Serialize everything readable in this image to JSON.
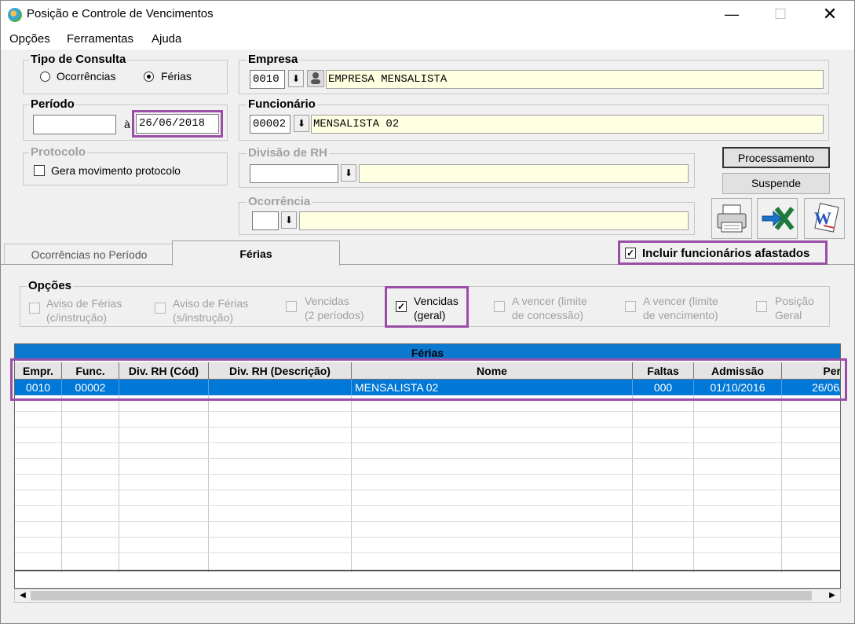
{
  "window": {
    "title": "Posição e Controle de Vencimentos"
  },
  "menu": [
    "Opções",
    "Ferramentas",
    "Ajuda"
  ],
  "tipo_consulta": {
    "label": "Tipo de Consulta",
    "options": [
      "Ocorrências",
      "Férias"
    ],
    "selected": "Férias"
  },
  "periodo": {
    "label": "Período",
    "from": "",
    "sep": "à",
    "to": "26/06/2018"
  },
  "protocolo": {
    "label": "Protocolo",
    "checkbox": "Gera movimento protocolo"
  },
  "empresa": {
    "label": "Empresa",
    "code": "0010",
    "name": "EMPRESA MENSALISTA"
  },
  "funcionario": {
    "label": "Funcionário",
    "code": "00002",
    "name": "MENSALISTA 02"
  },
  "divisao": {
    "label": "Divisão de RH",
    "code": "",
    "name": ""
  },
  "ocorrencia": {
    "label": "Ocorrência",
    "code": "",
    "name": ""
  },
  "buttons": {
    "processamento": "Processamento",
    "suspende": "Suspende"
  },
  "icon_buttons": [
    "printer-icon",
    "excel-export-icon",
    "word-export-icon"
  ],
  "tabs": [
    "Ocorrências no Período",
    "Férias"
  ],
  "active_tab": "Férias",
  "incluir_afastados": {
    "label": "Incluir funcionários afastados",
    "checked": true
  },
  "opcoes": {
    "label": "Opções",
    "items": [
      {
        "line1": "Aviso de Férias",
        "line2": "(c/instrução)",
        "checked": false,
        "enabled": false
      },
      {
        "line1": "Aviso de Férias",
        "line2": "(s/instrução)",
        "checked": false,
        "enabled": false
      },
      {
        "line1": "Vencidas",
        "line2": "(2 períodos)",
        "checked": false,
        "enabled": false
      },
      {
        "line1": "Vencidas",
        "line2": "(geral)",
        "checked": true,
        "enabled": true
      },
      {
        "line1": "A vencer (limite",
        "line2": "de concessão)",
        "checked": false,
        "enabled": false
      },
      {
        "line1": "A vencer (limite",
        "line2": "de vencimento)",
        "checked": false,
        "enabled": false
      },
      {
        "line1": "Posição",
        "line2": "Geral",
        "checked": false,
        "enabled": false
      }
    ]
  },
  "grid": {
    "title": "Férias",
    "columns": [
      "Empr.",
      "Func.",
      "Div. RH (Cód)",
      "Div. RH (Descrição)",
      "Nome",
      "Faltas",
      "Admissão",
      "Per"
    ],
    "rows": [
      [
        "0010",
        "00002",
        "",
        "",
        "MENSALISTA 02",
        "000",
        "01/10/2016",
        "26/06/"
      ]
    ]
  },
  "colors": {
    "highlight": "#9b4ea7",
    "selection": "#0078d7",
    "grid_title": "#0b79d0",
    "readonly_field": "#ffffe1"
  }
}
